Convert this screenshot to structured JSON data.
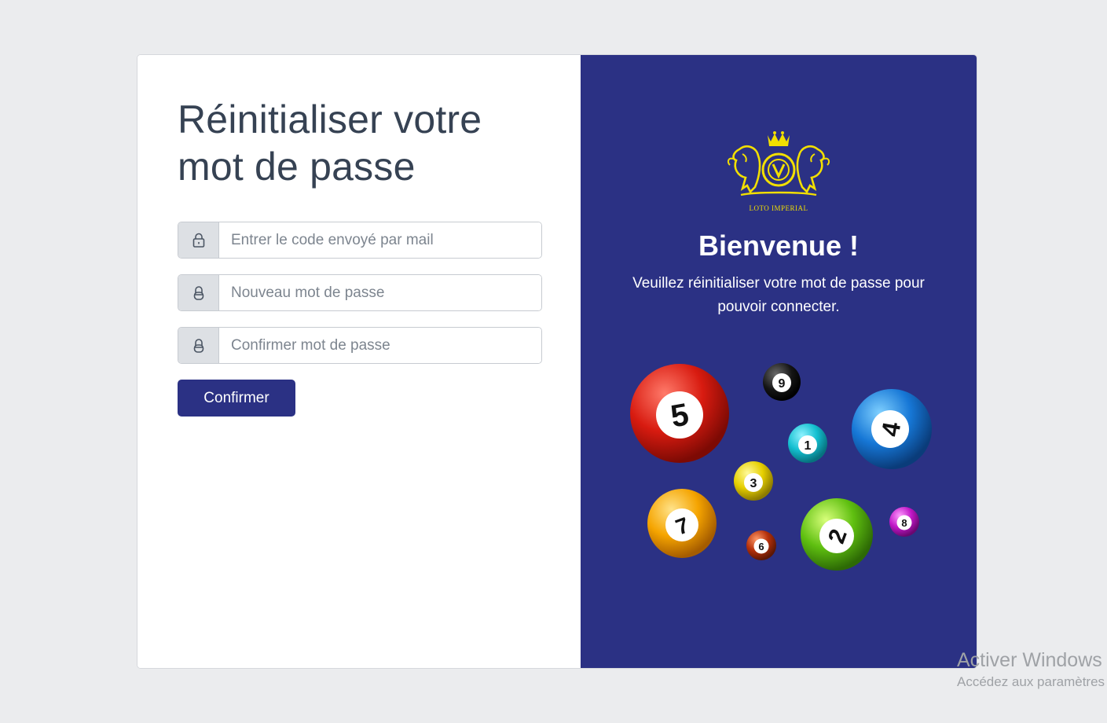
{
  "reset_form": {
    "title": "Réinitialiser votre mot de passe",
    "code_field": {
      "placeholder": "Entrer le code envoyé par mail",
      "value": ""
    },
    "new_password_field": {
      "placeholder": "Nouveau mot de passe",
      "value": ""
    },
    "confirm_password_field": {
      "placeholder": "Confirmer mot de passe",
      "value": ""
    },
    "submit_label": "Confirmer"
  },
  "welcome_panel": {
    "logo_text": "LOTO IMPERIAL",
    "title": "Bienvenue !",
    "message": "Veuillez réinitialiser votre mot de passe pour pouvoir connecter.",
    "ball_numbers": [
      "5",
      "9",
      "1",
      "4",
      "3",
      "7",
      "6",
      "2",
      "8"
    ]
  },
  "icons": {
    "code_field": "lock-icon",
    "new_password_field": "lock-icon",
    "confirm_password_field": "lock-icon"
  },
  "colors": {
    "brand": "#2b3184",
    "background": "#ebecee",
    "logo_gold": "#f2df00"
  },
  "watermark": {
    "title": "Activer Windows",
    "subtitle": "Accédez aux paramètres"
  }
}
